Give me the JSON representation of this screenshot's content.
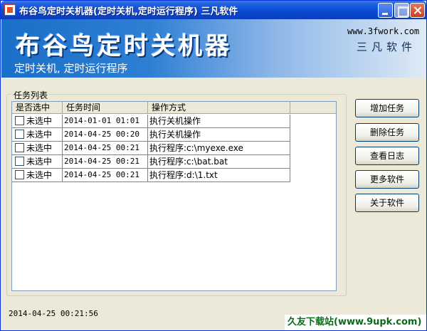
{
  "window": {
    "title": "布谷鸟定时关机器(定时关机,定时运行程序) 三凡软件"
  },
  "banner": {
    "title": "布谷鸟定时关机器",
    "subtitle": "定时关机, 定时运行程序",
    "url": "www.3fwork.com",
    "brand": "三凡软件"
  },
  "task_group": {
    "label": "任务列表",
    "columns": [
      "是否选中",
      "任务时间",
      "操作方式",
      ""
    ],
    "rows": [
      {
        "checked": false,
        "select_label": "未选中",
        "time": "2014-01-01 01:01",
        "action": "执行关机操作"
      },
      {
        "checked": false,
        "select_label": "未选中",
        "time": "2014-04-25 00:20",
        "action": "执行关机操作"
      },
      {
        "checked": false,
        "select_label": "未选中",
        "time": "2014-04-25 00:21",
        "action": "执行程序:c:\\myexe.exe"
      },
      {
        "checked": false,
        "select_label": "未选中",
        "time": "2014-04-25 00:21",
        "action": "执行程序:c:\\bat.bat"
      },
      {
        "checked": false,
        "select_label": "未选中",
        "time": "2014-04-25 00:21",
        "action": "执行程序:d:\\1.txt"
      }
    ]
  },
  "buttons": {
    "add": "增加任务",
    "delete": "删除任务",
    "log": "查看日志",
    "more": "更多软件",
    "about": "关于软件"
  },
  "status": {
    "time": "2014-04-25 00:21:56"
  },
  "watermark": "久友下载站(www.9upk.com)"
}
